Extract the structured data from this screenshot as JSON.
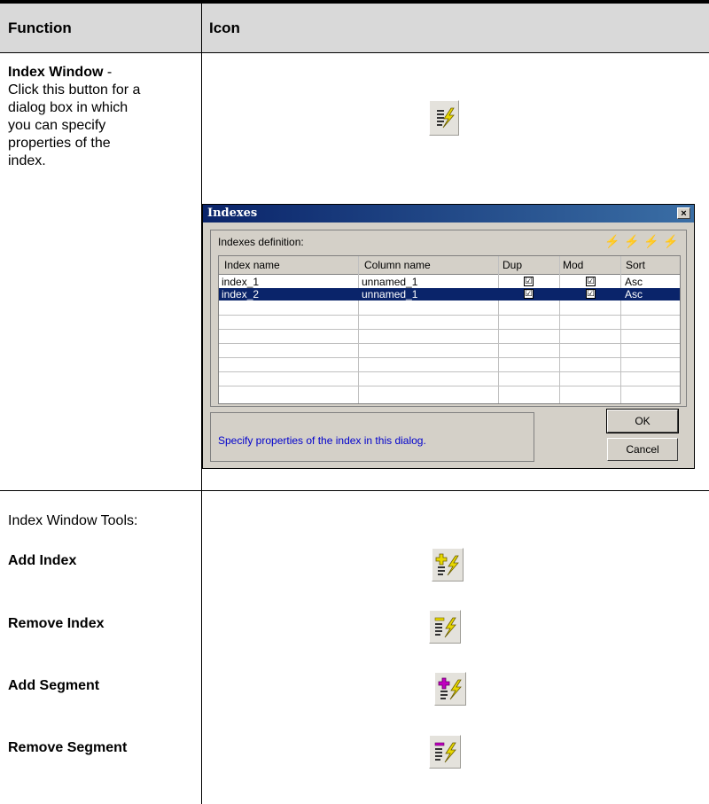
{
  "header": {
    "function_label": "Function",
    "icon_label": "Icon"
  },
  "index_window": {
    "title": "Index Window",
    "separator": " -",
    "description_lines": [
      "Click this button for a",
      "dialog box in which",
      "you can specify",
      "properties of the",
      "index."
    ]
  },
  "dialog": {
    "title": "Indexes",
    "close_glyph": "×",
    "group_label": "Indexes definition:",
    "columns": [
      "Index name",
      "Column name",
      "Dup",
      "Mod",
      "Sort"
    ],
    "rows": [
      {
        "index_name": "index_1",
        "column_name": "unnamed_1",
        "dup": "☑",
        "mod": "☑",
        "sort": "Asc",
        "selected": false
      },
      {
        "index_name": "index_2",
        "column_name": "unnamed_1",
        "dup": "☑",
        "mod": "☑",
        "sort": "Asc",
        "selected": true
      }
    ],
    "message": "Specify properties of the index in this dialog.",
    "ok_label": "OK",
    "cancel_label": "Cancel"
  },
  "tools": {
    "heading": "Index Window Tools:",
    "items": [
      "Add Index",
      "Remove Index",
      "Add Segment",
      "Remove Segment"
    ]
  },
  "icons": {
    "index_window": "index-lightning-icon",
    "add_index": "add-index-icon",
    "remove_index": "remove-index-icon",
    "add_segment": "add-segment-icon",
    "remove_segment": "remove-segment-icon"
  },
  "colors": {
    "lightning": "#e8d800",
    "add_plus": "#e8d800",
    "segment_plus": "#c000c0",
    "selection": "#0a246a",
    "message": "#0000cc"
  }
}
